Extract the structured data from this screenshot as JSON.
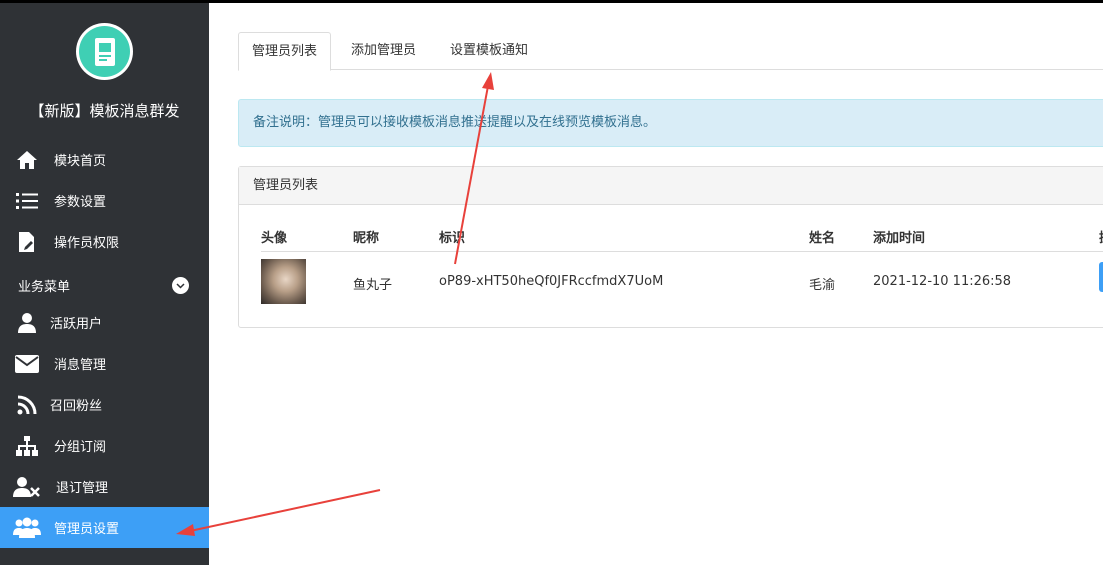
{
  "app": {
    "title": "【新版】模板消息群发"
  },
  "sidebar": {
    "items": [
      {
        "label": "模块首页",
        "icon": "home-icon"
      },
      {
        "label": "参数设置",
        "icon": "list-icon"
      },
      {
        "label": "操作员权限",
        "icon": "document-edit-icon"
      }
    ],
    "section_label": "业务菜单",
    "business_items": [
      {
        "label": "活跃用户",
        "icon": "user-icon"
      },
      {
        "label": "消息管理",
        "icon": "envelope-icon"
      },
      {
        "label": "召回粉丝",
        "icon": "rss-icon"
      },
      {
        "label": "分组订阅",
        "icon": "sitemap-icon"
      },
      {
        "label": "退订管理",
        "icon": "user-remove-icon"
      },
      {
        "label": "管理员设置",
        "icon": "users-icon",
        "active": true
      }
    ]
  },
  "tabs": [
    {
      "label": "管理员列表",
      "active": true
    },
    {
      "label": "添加管理员"
    },
    {
      "label": "设置模板通知"
    }
  ],
  "alert": {
    "text": "备注说明：管理员可以接收模板消息推送提醒以及在线预览模板消息。"
  },
  "panel": {
    "title": "管理员列表",
    "columns": [
      "头像",
      "昵称",
      "标识",
      "姓名",
      "添加时间",
      "操"
    ],
    "rows": [
      {
        "nickname": "鱼丸子",
        "openid": "oP89-xHT50heQf0JFRccfmdX7UoM",
        "name": "毛渝",
        "added": "2021-12-10 11:26:58"
      }
    ]
  },
  "colors": {
    "sidebar_bg": "#2f3236",
    "active_bg": "#3d9ff6",
    "alert_bg": "#d9edf7",
    "arrow": "#e8413b"
  }
}
